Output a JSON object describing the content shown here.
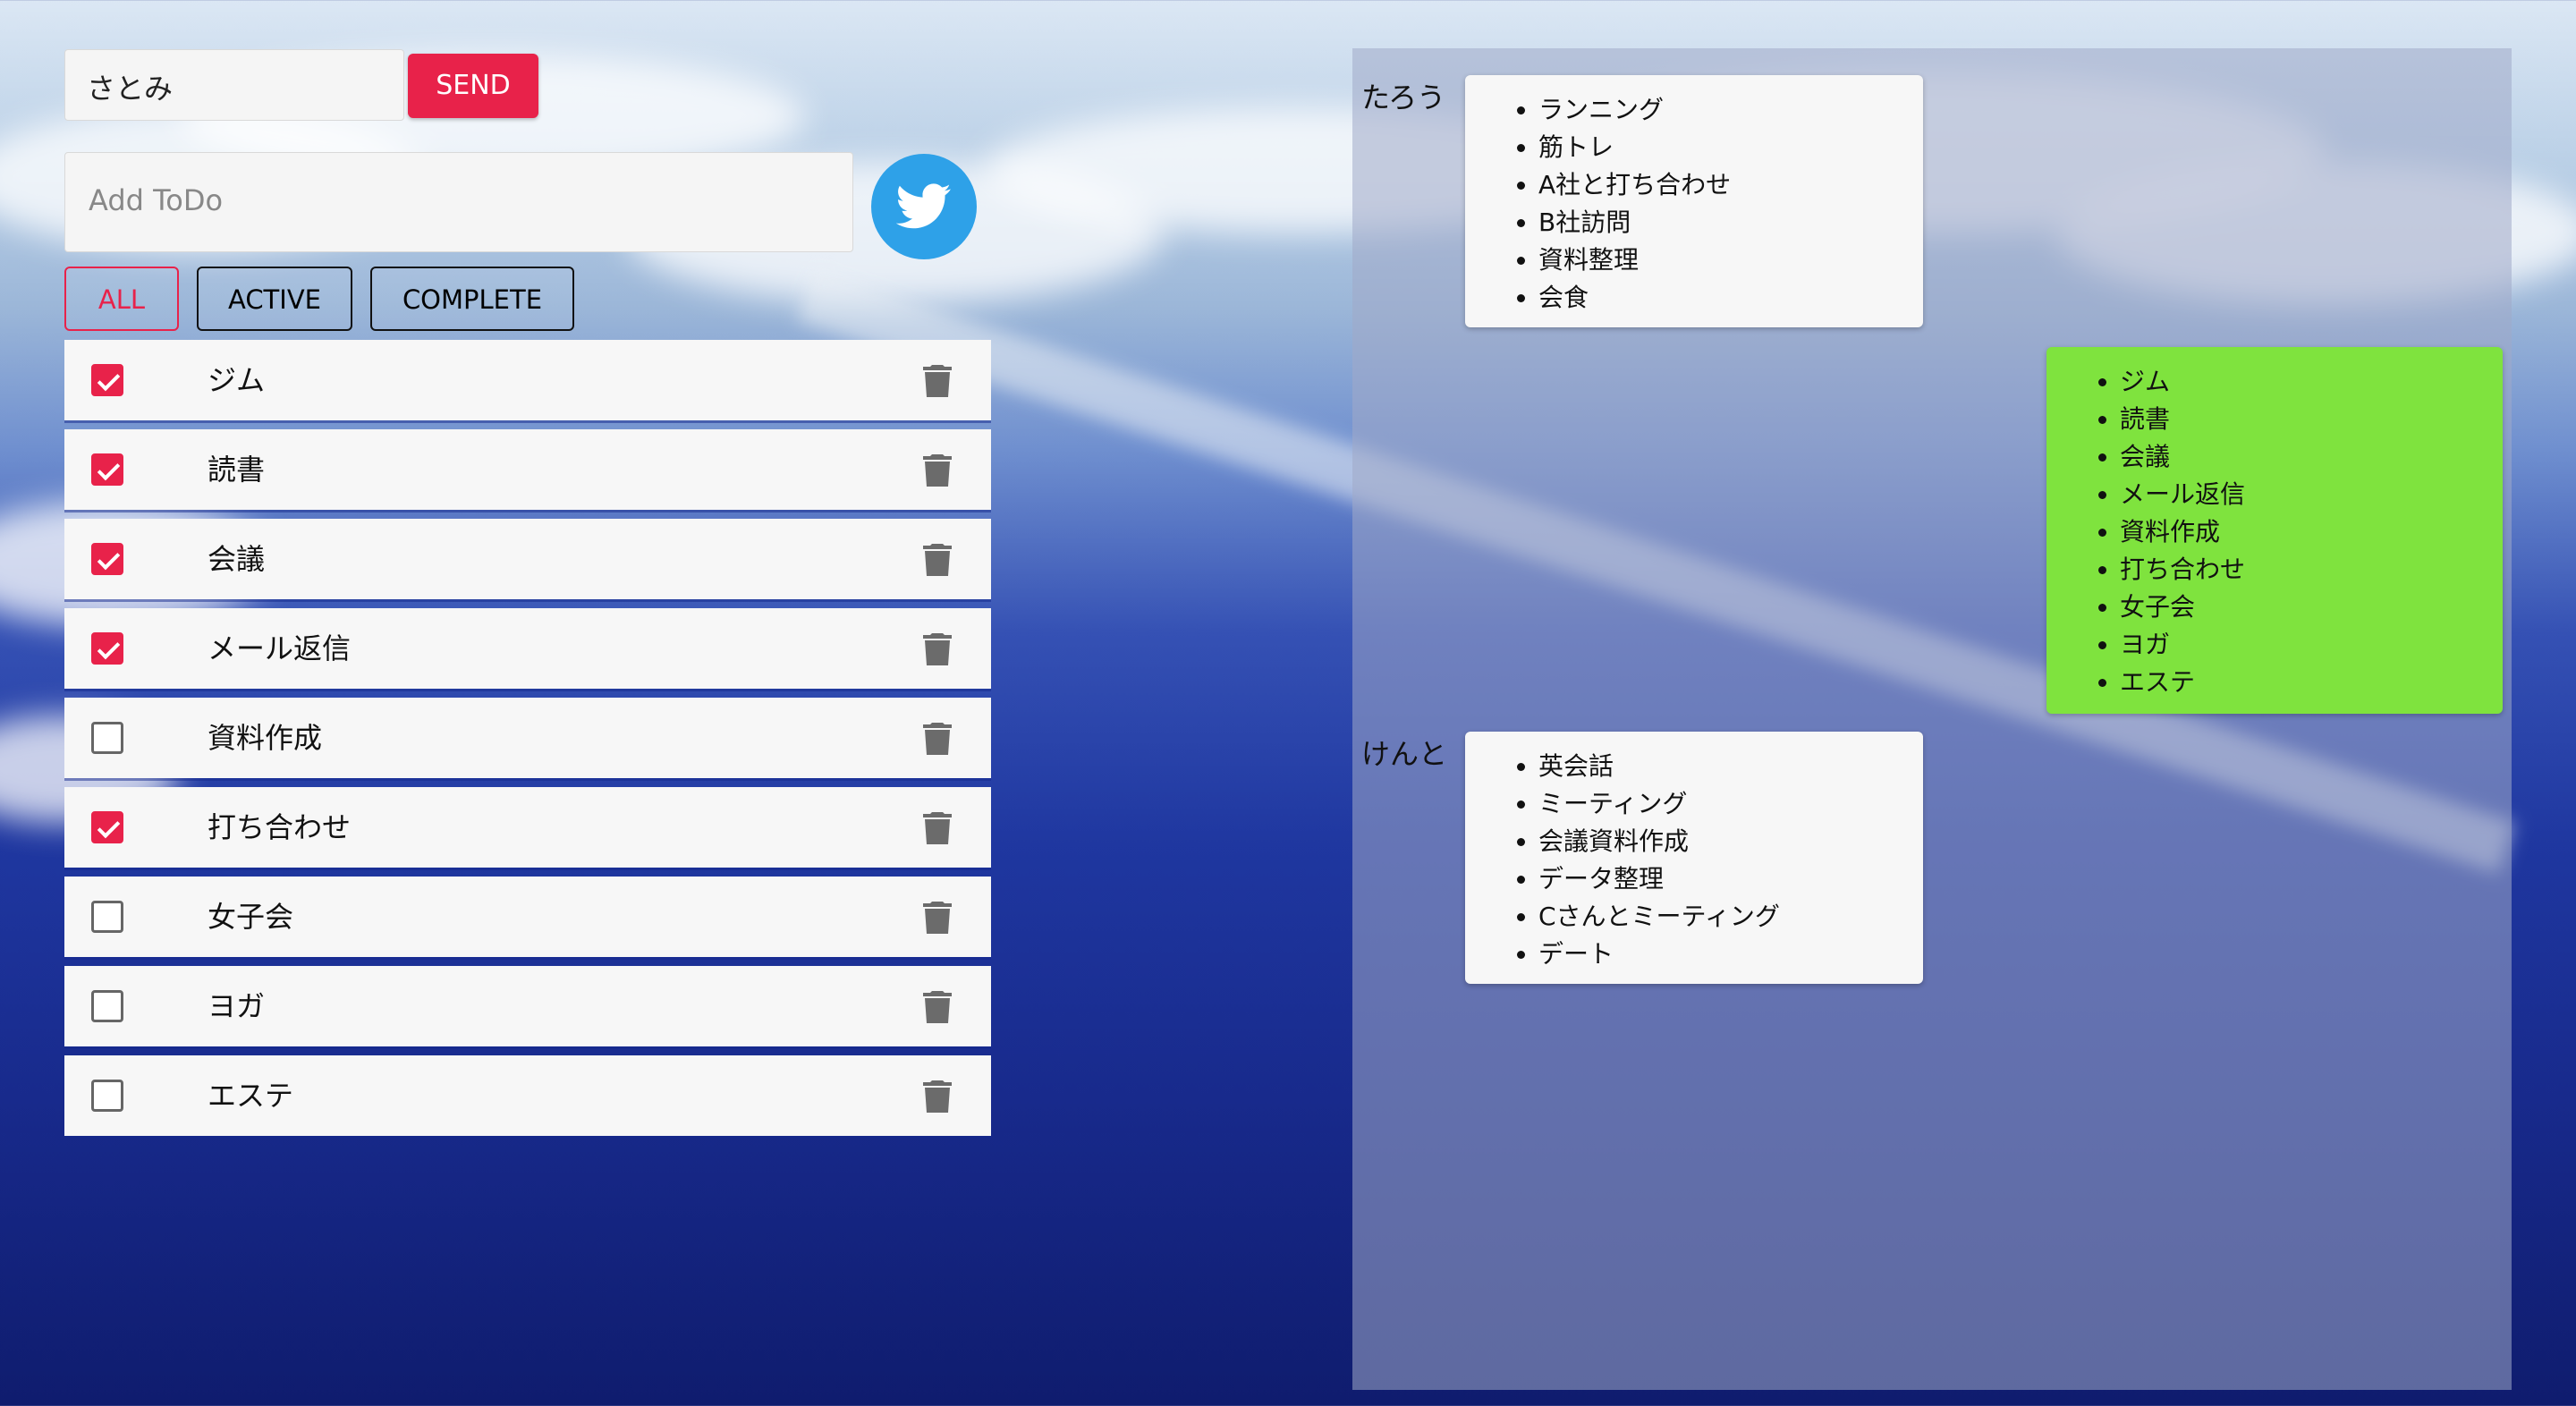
{
  "name_input": {
    "value": "さとみ"
  },
  "send_label": "SEND",
  "todo_input": {
    "placeholder": "Add ToDo"
  },
  "filters": [
    {
      "label": "ALL",
      "selected": true
    },
    {
      "label": "ACTIVE",
      "selected": false
    },
    {
      "label": "COMPLETE",
      "selected": false
    }
  ],
  "todos": [
    {
      "text": "ジム",
      "done": true
    },
    {
      "text": "読書",
      "done": true
    },
    {
      "text": "会議",
      "done": true
    },
    {
      "text": "メール返信",
      "done": true
    },
    {
      "text": "資料作成",
      "done": false
    },
    {
      "text": "打ち合わせ",
      "done": true
    },
    {
      "text": "女子会",
      "done": false
    },
    {
      "text": "ヨガ",
      "done": false
    },
    {
      "text": "エステ",
      "done": false
    }
  ],
  "users": [
    {
      "name": "たろう",
      "items": [
        "ランニング",
        "筋トレ",
        "A社と打ち合わせ",
        "B社訪問",
        "資料整理",
        "会食"
      ]
    },
    {
      "name": "",
      "items": [
        "ジム",
        "読書",
        "会議",
        "メール返信",
        "資料作成",
        "打ち合わせ",
        "女子会",
        "ヨガ",
        "エステ"
      ]
    },
    {
      "name": "けんと",
      "items": [
        "英会話",
        "ミーティング",
        "会議資料作成",
        "データ整理",
        "Cさんとミーティング",
        "デート"
      ]
    }
  ],
  "colors": {
    "accent": "#e8224a",
    "twitter": "#2ea1e8",
    "highlight_card": "#7fe33e"
  },
  "icons": {
    "twitter": "twitter-bird-icon",
    "delete": "trash-icon"
  }
}
